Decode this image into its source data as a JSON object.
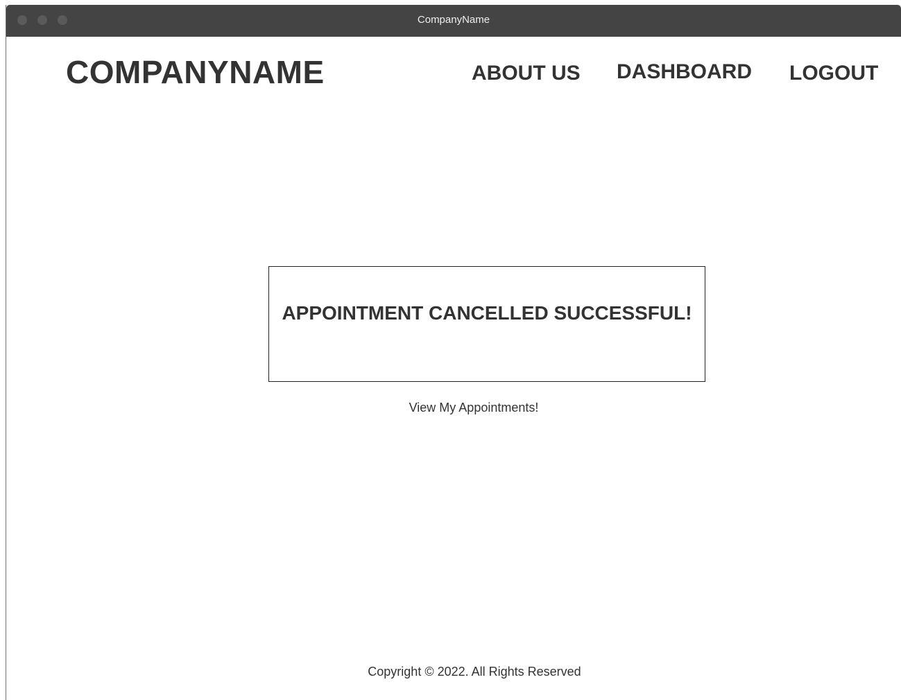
{
  "window": {
    "title": "CompanyName"
  },
  "header": {
    "brand": "COMPANYNAME",
    "nav": {
      "about": "ABOUT US",
      "dashboard": "DASHBOARD",
      "logout": "LOGOUT"
    }
  },
  "main": {
    "message": "APPOINTMENT CANCELLED SUCCESSFUL!",
    "view_link": "View My Appointments!"
  },
  "footer": {
    "copyright": "Copyright  © 2022. All Rights Reserved"
  },
  "colors": {
    "titlebar": "#444444",
    "text": "#333333",
    "background": "#ffffff"
  }
}
